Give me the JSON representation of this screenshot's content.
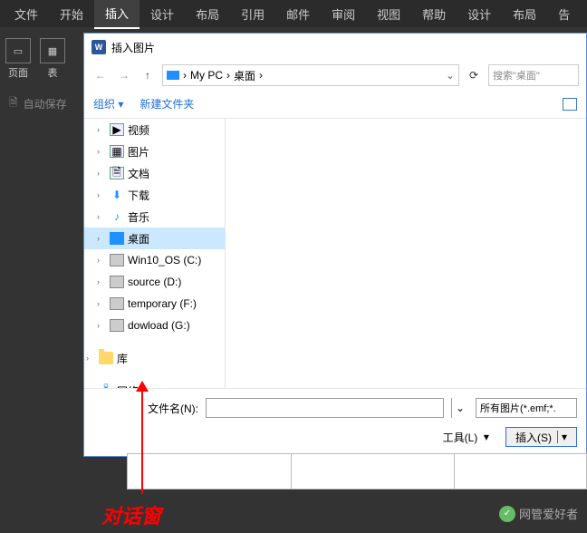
{
  "ribbon": {
    "tabs": [
      "文件",
      "开始",
      "插入",
      "设计",
      "布局",
      "引用",
      "邮件",
      "审阅",
      "视图",
      "帮助",
      "设计",
      "布局",
      "告"
    ],
    "active_index": 2,
    "panel": {
      "page": "页面",
      "table": "表",
      "table2": "表"
    }
  },
  "autosave": "自动保存",
  "dialog": {
    "title": "插入图片",
    "nav": {
      "back": "←",
      "forward": "→",
      "up": "↑",
      "breadcrumb": [
        "My PC",
        "桌面"
      ],
      "refresh": "⟳",
      "search_placeholder": "搜索\"桌面\""
    },
    "toolbar": {
      "organize": "组织",
      "new_folder": "新建文件夹"
    },
    "tree": [
      {
        "label": "视频",
        "icon": "video",
        "expandable": true
      },
      {
        "label": "图片",
        "icon": "pic",
        "expandable": true
      },
      {
        "label": "文档",
        "icon": "doc",
        "expandable": true
      },
      {
        "label": "下载",
        "icon": "download",
        "expandable": true
      },
      {
        "label": "音乐",
        "icon": "music",
        "expandable": true
      },
      {
        "label": "桌面",
        "icon": "desktop",
        "expandable": true,
        "selected": true
      },
      {
        "label": "Win10_OS (C:)",
        "icon": "drive",
        "expandable": true
      },
      {
        "label": "source (D:)",
        "icon": "drive",
        "expandable": true
      },
      {
        "label": "temporary (F:)",
        "icon": "drive",
        "expandable": true
      },
      {
        "label": "dowload (G:)",
        "icon": "drive",
        "expandable": true
      },
      {
        "spacer": true
      },
      {
        "label": "库",
        "icon": "folder",
        "expandable": true,
        "top": true
      },
      {
        "spacer": true
      },
      {
        "label": "网络",
        "icon": "network",
        "expandable": true,
        "top": true
      }
    ],
    "footer": {
      "filename_label": "文件名(N):",
      "filename_value": "",
      "filter": "所有图片(*.emf;*.",
      "tools": "工具(L)",
      "insert": "插入(S)"
    }
  },
  "annotation": "对话窗",
  "watermark": "网管爱好者"
}
